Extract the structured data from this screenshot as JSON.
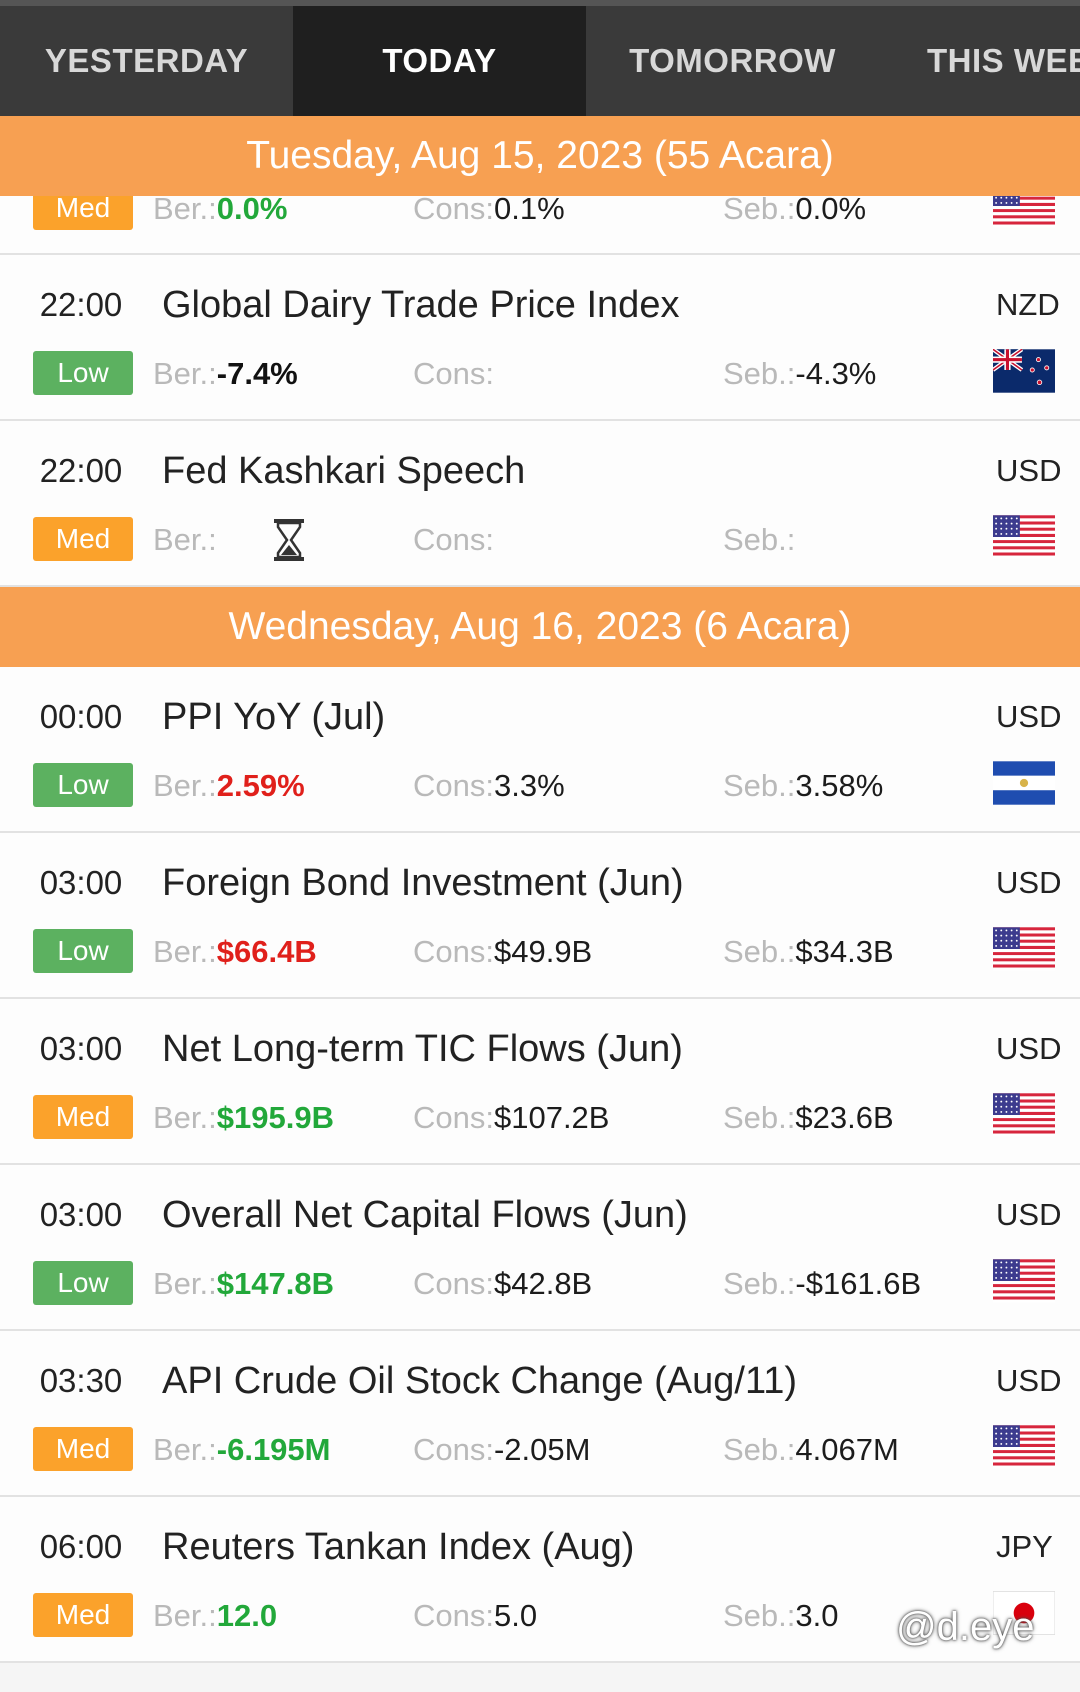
{
  "tabs": [
    "YESTERDAY",
    "TODAY",
    "TOMORROW",
    "THIS WEE"
  ],
  "colors": {
    "header_bg": "#f7a052",
    "impact_med": "#fba22b",
    "impact_low": "#5cb160",
    "actual_up": "#22a83a",
    "actual_down": "#e0201b"
  },
  "days": [
    {
      "header": "Tuesday, Aug 15, 2023 (55 Acara)",
      "events": [
        {
          "partial": true,
          "time": "",
          "title": "",
          "currency": "",
          "impact": "Med",
          "impact_level": "med",
          "ber_label": "Ber.:",
          "actual": "0.0%",
          "actual_color": "green",
          "cons_label": "Cons:",
          "consensus": "0.1%",
          "seb_label": "Seb.:",
          "previous": "0.0%",
          "flag": "us-flag"
        },
        {
          "time": "22:00",
          "title": "Global Dairy Trade Price Index",
          "currency": "NZD",
          "impact": "Low",
          "impact_level": "low",
          "ber_label": "Ber.:",
          "actual": "-7.4%",
          "actual_color": "black",
          "cons_label": "Cons:",
          "consensus": "",
          "seb_label": "Seb.:",
          "previous": "-4.3%",
          "flag": "nz-flag"
        },
        {
          "time": "22:00",
          "title": "Fed Kashkari Speech",
          "currency": "USD",
          "impact": "Med",
          "impact_level": "med",
          "ber_label": "Ber.:",
          "actual": "",
          "actual_pending": true,
          "actual_color": "black",
          "cons_label": "Cons:",
          "consensus": "",
          "seb_label": "Seb.:",
          "previous": "",
          "flag": "us-flag"
        }
      ]
    },
    {
      "header": "Wednesday, Aug 16, 2023 (6 Acara)",
      "events": [
        {
          "time": "00:00",
          "title": "PPI YoY (Jul)",
          "currency": "USD",
          "impact": "Low",
          "impact_level": "low",
          "ber_label": "Ber.:",
          "actual": "2.59%",
          "actual_color": "red",
          "cons_label": "Cons:",
          "consensus": "3.3%",
          "seb_label": "Seb.:",
          "previous": "3.58%",
          "flag": "sv-flag"
        },
        {
          "time": "03:00",
          "title": "Foreign Bond Investment (Jun)",
          "currency": "USD",
          "impact": "Low",
          "impact_level": "low",
          "ber_label": "Ber.:",
          "actual": "$66.4B",
          "actual_color": "red",
          "cons_label": "Cons:",
          "consensus": "$49.9B",
          "seb_label": "Seb.:",
          "previous": "$34.3B",
          "flag": "us-flag"
        },
        {
          "time": "03:00",
          "title": "Net Long-term TIC Flows (Jun)",
          "currency": "USD",
          "impact": "Med",
          "impact_level": "med",
          "ber_label": "Ber.:",
          "actual": "$195.9B",
          "actual_color": "green",
          "cons_label": "Cons:",
          "consensus": "$107.2B",
          "seb_label": "Seb.:",
          "previous": "$23.6B",
          "flag": "us-flag"
        },
        {
          "time": "03:00",
          "title": "Overall Net Capital Flows (Jun)",
          "currency": "USD",
          "impact": "Low",
          "impact_level": "low",
          "ber_label": "Ber.:",
          "actual": "$147.8B",
          "actual_color": "green",
          "cons_label": "Cons:",
          "consensus": "$42.8B",
          "seb_label": "Seb.:",
          "previous": "-$161.6B",
          "flag": "us-flag"
        },
        {
          "time": "03:30",
          "title": "API Crude Oil Stock Change (Aug/11)",
          "currency": "USD",
          "impact": "Med",
          "impact_level": "med",
          "ber_label": "Ber.:",
          "actual": "-6.195M",
          "actual_color": "green",
          "cons_label": "Cons:",
          "consensus": "-2.05M",
          "seb_label": "Seb.:",
          "previous": "4.067M",
          "flag": "us-flag"
        },
        {
          "time": "06:00",
          "title": "Reuters Tankan Index (Aug)",
          "currency": "JPY",
          "impact": "Med",
          "impact_level": "med",
          "ber_label": "Ber.:",
          "actual": "12.0",
          "actual_color": "green",
          "cons_label": "Cons:",
          "consensus": "5.0",
          "seb_label": "Seb.:",
          "previous": "3.0",
          "flag": "jp-flag"
        }
      ]
    }
  ],
  "watermark": "@d.eye"
}
